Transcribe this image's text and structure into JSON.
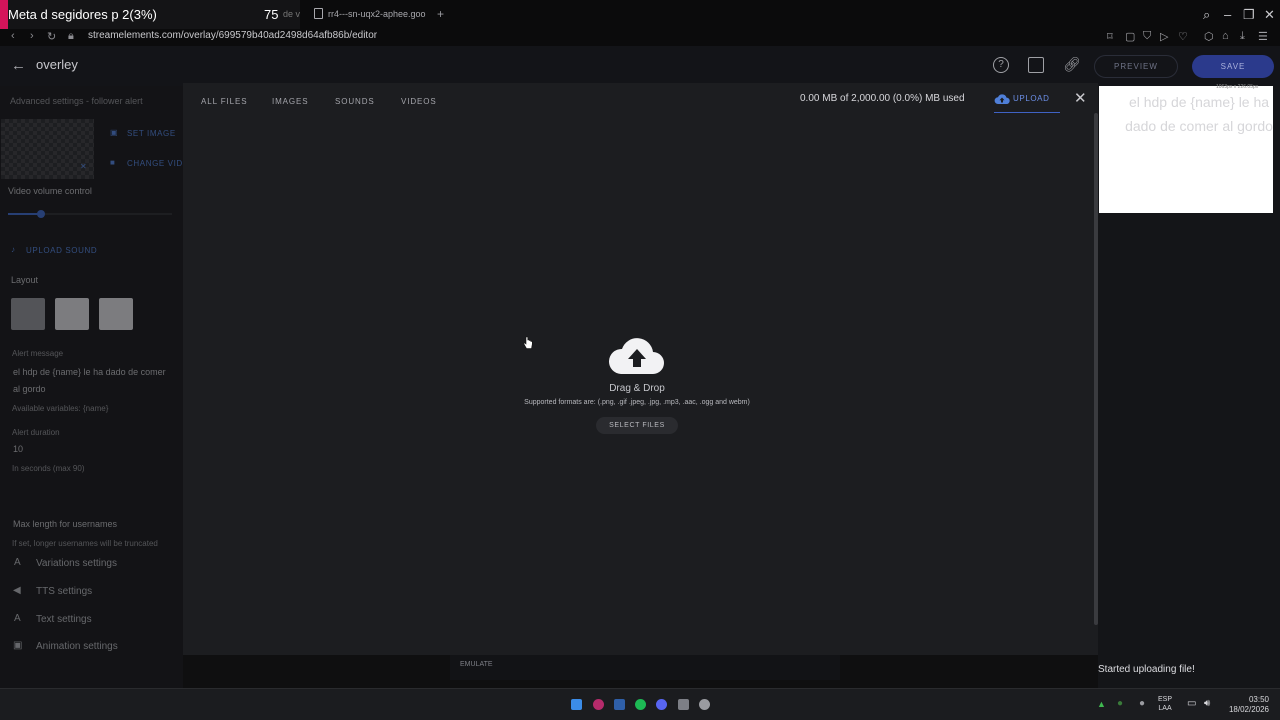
{
  "browser": {
    "active_tab_title": "Meta d segidores p 2(3%)",
    "active_tab_count": "75",
    "active_tab_extra": "de v",
    "second_tab_title": "rr4---sn-uqx2-aphee.goo",
    "new_tab_icon": "plus-icon",
    "url": "streamelements.com/overlay/699579b40ad2498d64afb86b/editor"
  },
  "header": {
    "overlay_name": "overley",
    "preview_label": "PREVIEW",
    "save_label": "SAVE",
    "icons": [
      "help-icon",
      "screen-icon",
      "link-icon"
    ]
  },
  "sidebar": {
    "section_title": "Advanced settings - follower alert",
    "set_image": "SET IMAGE",
    "change_video": "CHANGE VID",
    "video_volume_label": "Video volume control",
    "video_volume_level": 0.2,
    "upload_sound": "UPLOAD SOUND",
    "layout_label": "Layout",
    "alert_message_label": "Alert message",
    "alert_message_value": "el hdp de {name} le ha dado de comer al gordo",
    "available_variables": "Available variables: {name}",
    "alert_duration_label": "Alert duration",
    "alert_duration_value": "10",
    "alert_duration_hint": "In seconds (max 90)",
    "max_length_label": "Max length for usernames",
    "max_length_hint": "If set, longer usernames will be truncated",
    "accordions": [
      {
        "label": "Variations settings",
        "icon": "text-icon"
      },
      {
        "label": "TTS settings",
        "icon": "speaker-icon"
      },
      {
        "label": "Text settings",
        "icon": "text-icon"
      },
      {
        "label": "Animation settings",
        "icon": "image-icon"
      }
    ]
  },
  "modal": {
    "tabs": [
      "ALL FILES",
      "IMAGES",
      "SOUNDS",
      "VIDEOS"
    ],
    "storage_used": "0.00 MB of 2,000.00 (0.0%) MB used",
    "upload_tab": "UPLOAD",
    "drop_title": "Drag & Drop",
    "supported_formats": "Supported formats are: (.png, .gif .jpeg, .jpg, .mp3, .aac, .ogg and webm)",
    "select_files": "SELECT FILES"
  },
  "preview": {
    "text": "el hdp de {name} le ha dado de comer al gordo",
    "dim_label": "1063px x 226.05px"
  },
  "bottom_toolbar": {
    "emulate_label": "EMULATE"
  },
  "toast": "Started uploading file!",
  "taskbar": {
    "lang_line1": "ESP",
    "lang_line2": "LAA",
    "time": "03:50",
    "date": "18/02/2026"
  },
  "colors": {
    "accent_blue": "#3f62c4",
    "save_button": "#2b3a8c",
    "tab_accent": "#d4145a"
  }
}
